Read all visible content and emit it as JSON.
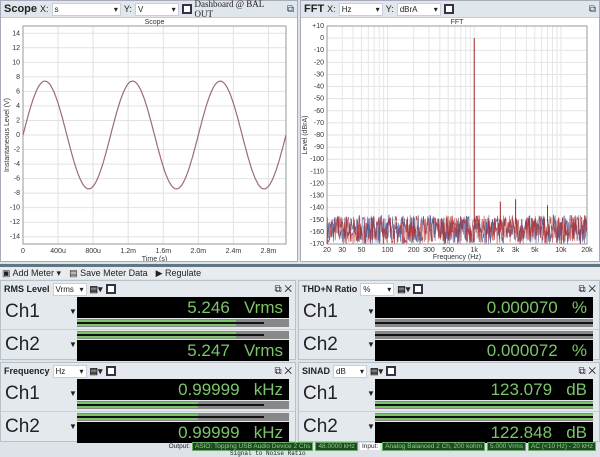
{
  "scope": {
    "title": "Scope",
    "x_label": "X:",
    "x_unit": "s",
    "y_label": "Y:",
    "y_unit": "V",
    "source": "Dashboard @ BAL OUT"
  },
  "fft": {
    "title": "FFT",
    "x_label": "X:",
    "x_unit": "Hz",
    "y_label": "Y:",
    "y_unit": "dBrA"
  },
  "toolbar": {
    "add_meter": "Add Meter",
    "save": "Save Meter Data",
    "regulate": "Regulate"
  },
  "chart_data": [
    {
      "type": "line",
      "title": "Scope",
      "xlabel": "Time (s)",
      "ylabel": "Instantaneous Level (V)",
      "xlim": [
        0,
        0.003
      ],
      "ylim": [
        -15,
        15
      ],
      "xticks": [
        "0",
        "400u",
        "800u",
        "1.2m",
        "1.6m",
        "2.0m",
        "2.4m",
        "2.8m"
      ],
      "yticks": [
        "14",
        "12",
        "10",
        "8",
        "6",
        "4",
        "2",
        "0",
        "-2",
        "-4",
        "-6",
        "-8",
        "-10",
        "-12",
        "-14"
      ],
      "series": [
        {
          "waveform": "sine",
          "frequency_hz": 1000,
          "amplitude_v": 7.42,
          "color": "#9a6b78"
        }
      ],
      "grid": true
    },
    {
      "type": "line",
      "title": "FFT",
      "xlabel": "Frequency (Hz)",
      "ylabel": "Level (dBrA)",
      "xscale": "log",
      "xlim": [
        20,
        20000
      ],
      "ylim": [
        -170,
        10
      ],
      "xticks": [
        "20",
        "30",
        "50",
        "100",
        "200",
        "300",
        "500",
        "1k",
        "2k",
        "3k",
        "5k",
        "10k",
        "20k"
      ],
      "yticks": [
        "+10",
        "0",
        "-10",
        "-20",
        "-30",
        "-40",
        "-50",
        "-60",
        "-70",
        "-80",
        "-90",
        "-100",
        "-110",
        "-120",
        "-130",
        "-140",
        "-150",
        "-160",
        "-170"
      ],
      "peaks": [
        {
          "x": 1000,
          "y": 0
        },
        {
          "x": 2000,
          "y": -135
        },
        {
          "x": 3000,
          "y": -133
        },
        {
          "x": 7000,
          "y": -138
        }
      ],
      "noise_floor": [
        -170,
        -150
      ],
      "series_colors": [
        "#b03030",
        "#404a8a"
      ],
      "grid": true
    }
  ],
  "meters": [
    {
      "title": "RMS Level",
      "unit_sel": "Vrms",
      "rows": [
        {
          "ch": "Ch1",
          "value": "5.246",
          "unit": "Vrms",
          "level": 0.75
        },
        {
          "ch": "Ch2",
          "value": "5.247",
          "unit": "Vrms",
          "level": 0.75
        }
      ]
    },
    {
      "title": "THD+N Ratio",
      "unit_sel": "%",
      "rows": [
        {
          "ch": "Ch1",
          "value": "0.000070",
          "unit": "%",
          "level": 0
        },
        {
          "ch": "Ch2",
          "value": "0.000072",
          "unit": "%",
          "level": 0
        }
      ]
    },
    {
      "title": "Frequency",
      "unit_sel": "Hz",
      "rows": [
        {
          "ch": "Ch1",
          "value": "0.99999",
          "unit": "kHz",
          "level": 0.57
        },
        {
          "ch": "Ch2",
          "value": "0.99999",
          "unit": "kHz",
          "level": 0.57
        }
      ]
    },
    {
      "title": "SINAD",
      "unit_sel": "dB",
      "rows": [
        {
          "ch": "Ch1",
          "value": "123.079",
          "unit": "dB",
          "level": 1
        },
        {
          "ch": "Ch2",
          "value": "122.848",
          "unit": "dB",
          "level": 1
        }
      ]
    }
  ],
  "status": {
    "output_label": "Output:",
    "output": "ASIO: Topping USB Audio Device 2 Chs",
    "output_rate": "48.0000 kHz",
    "input_label": "Input:",
    "input": "Analog Balanced 2 Ch, 200 kohm",
    "input_range": "5.000 Vrms",
    "input_filter": "AC (<10 Hz) - 20 kHz"
  },
  "footer": "Signal to Noise Ratio"
}
